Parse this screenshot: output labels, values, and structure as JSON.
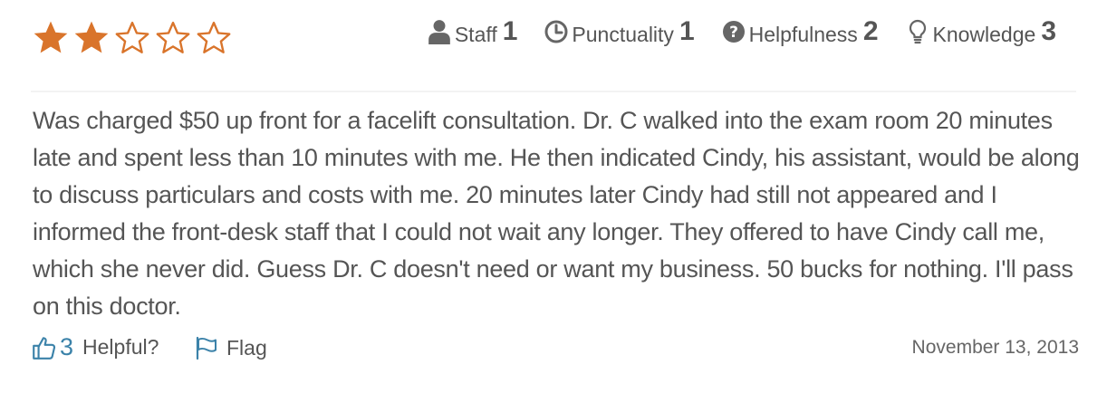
{
  "rating": {
    "value": 2,
    "max": 5,
    "filled_color": "#d9742b",
    "empty_color": "#d9742b"
  },
  "metrics": [
    {
      "icon": "user-icon",
      "label": "Staff",
      "value": "1"
    },
    {
      "icon": "clock-icon",
      "label": "Punctuality",
      "value": "1"
    },
    {
      "icon": "question-circle-icon",
      "label": "Helpfulness",
      "value": "2"
    },
    {
      "icon": "lightbulb-icon",
      "label": "Knowledge",
      "value": "3"
    }
  ],
  "review": {
    "text": "Was charged $50 up front for a facelift consultation. Dr. C walked into the exam room 20 minutes late and spent less than 10 minutes with me. He then indicated Cindy, his assistant, would be along to discuss particulars and costs with me. 20 minutes later Cindy had still not appeared and I informed the front-desk staff that I could not wait any longer. They offered to have Cindy call me, which she never did. Guess Dr. C doesn't need or want my business. 50 bucks for nothing. I'll pass on this doctor."
  },
  "footer": {
    "helpful_count": "3",
    "helpful_label": "Helpful?",
    "flag_label": "Flag",
    "date": "November 13, 2013"
  },
  "colors": {
    "accent": "#3b82a9",
    "text": "#555555",
    "star": "#d9742b"
  }
}
